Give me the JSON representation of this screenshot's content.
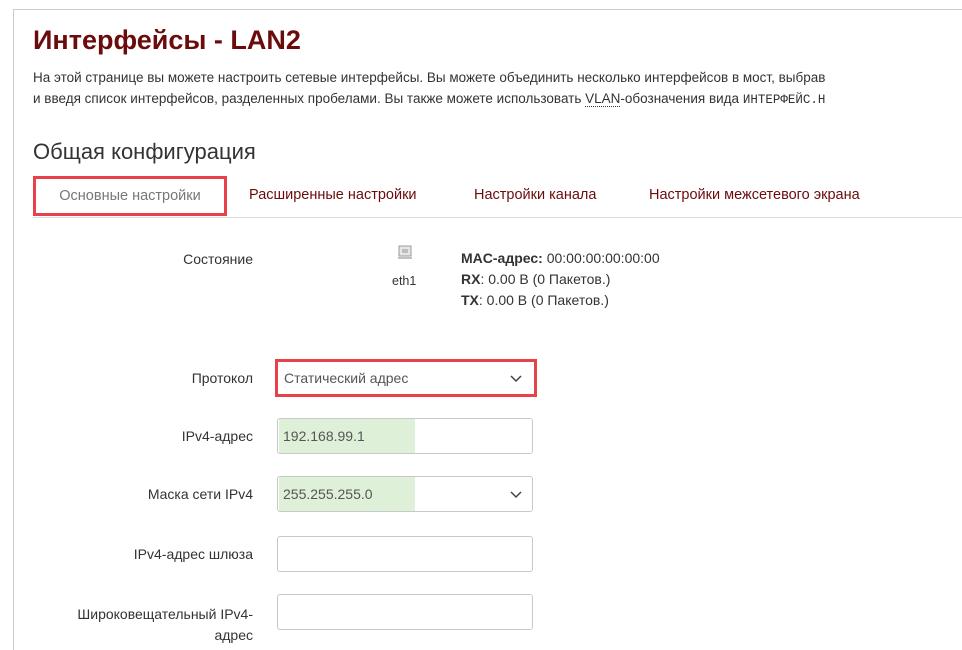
{
  "page": {
    "title": "Интерфейсы - LAN2",
    "desc_line1": "На этой странице вы можете настроить сетевые интерфейсы. Вы можете объединить несколько интерфейсов в мост, выбрав",
    "desc_line2_a": "и введя список интерфейсов, разделенных пробелами. Вы также можете использовать ",
    "desc_line2_abbr": "VLAN",
    "desc_line2_b": "-обозначения вида ",
    "desc_line2_mono": "ИНТЕРФЕЙС.Н"
  },
  "section": {
    "title": "Общая конфигурация"
  },
  "tabs": [
    {
      "label": "Основные настройки",
      "active": true
    },
    {
      "label": "Расширенные настройки"
    },
    {
      "label": "Настройки канала"
    },
    {
      "label": "Настройки межсетевого экрана"
    }
  ],
  "status": {
    "label": "Состояние",
    "device": "eth1",
    "icon": "network-port-icon",
    "mac_key": "MAC-адрес:",
    "mac_val": " 00:00:00:00:00:00",
    "rx_key": "RX",
    "rx_val": ": 0.00 B (0 Пакетов.)",
    "tx_key": "TX",
    "tx_val": ": 0.00 B (0 Пакетов.)"
  },
  "form": {
    "protocol_label": "Протокол",
    "protocol_value": "Статический адрес",
    "ipv4_label": "IPv4-адрес",
    "ipv4_value": "192.168.99.1",
    "mask_label": "Маска сети IPv4",
    "mask_value": "255.255.255.0",
    "gateway_label": "IPv4-адрес шлюза",
    "gateway_value": "",
    "broadcast_label_1": "Широковещательный IPv4-",
    "broadcast_label_2": "адрес",
    "broadcast_value": ""
  },
  "colors": {
    "title": "#6b0c0c",
    "highlight_border": "#e8414a",
    "field_highlight": "#dff0d8"
  }
}
